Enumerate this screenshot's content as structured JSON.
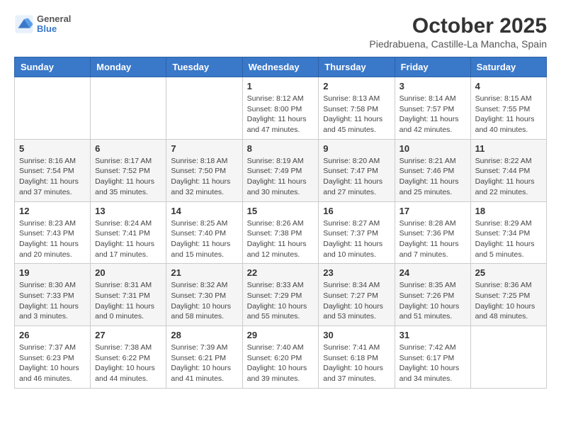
{
  "header": {
    "logo_general": "General",
    "logo_blue": "Blue",
    "month": "October 2025",
    "location": "Piedrabuena, Castille-La Mancha, Spain"
  },
  "weekdays": [
    "Sunday",
    "Monday",
    "Tuesday",
    "Wednesday",
    "Thursday",
    "Friday",
    "Saturday"
  ],
  "weeks": [
    [
      {
        "day": "",
        "info": ""
      },
      {
        "day": "",
        "info": ""
      },
      {
        "day": "",
        "info": ""
      },
      {
        "day": "1",
        "info": "Sunrise: 8:12 AM\nSunset: 8:00 PM\nDaylight: 11 hours and 47 minutes."
      },
      {
        "day": "2",
        "info": "Sunrise: 8:13 AM\nSunset: 7:58 PM\nDaylight: 11 hours and 45 minutes."
      },
      {
        "day": "3",
        "info": "Sunrise: 8:14 AM\nSunset: 7:57 PM\nDaylight: 11 hours and 42 minutes."
      },
      {
        "day": "4",
        "info": "Sunrise: 8:15 AM\nSunset: 7:55 PM\nDaylight: 11 hours and 40 minutes."
      }
    ],
    [
      {
        "day": "5",
        "info": "Sunrise: 8:16 AM\nSunset: 7:54 PM\nDaylight: 11 hours and 37 minutes."
      },
      {
        "day": "6",
        "info": "Sunrise: 8:17 AM\nSunset: 7:52 PM\nDaylight: 11 hours and 35 minutes."
      },
      {
        "day": "7",
        "info": "Sunrise: 8:18 AM\nSunset: 7:50 PM\nDaylight: 11 hours and 32 minutes."
      },
      {
        "day": "8",
        "info": "Sunrise: 8:19 AM\nSunset: 7:49 PM\nDaylight: 11 hours and 30 minutes."
      },
      {
        "day": "9",
        "info": "Sunrise: 8:20 AM\nSunset: 7:47 PM\nDaylight: 11 hours and 27 minutes."
      },
      {
        "day": "10",
        "info": "Sunrise: 8:21 AM\nSunset: 7:46 PM\nDaylight: 11 hours and 25 minutes."
      },
      {
        "day": "11",
        "info": "Sunrise: 8:22 AM\nSunset: 7:44 PM\nDaylight: 11 hours and 22 minutes."
      }
    ],
    [
      {
        "day": "12",
        "info": "Sunrise: 8:23 AM\nSunset: 7:43 PM\nDaylight: 11 hours and 20 minutes."
      },
      {
        "day": "13",
        "info": "Sunrise: 8:24 AM\nSunset: 7:41 PM\nDaylight: 11 hours and 17 minutes."
      },
      {
        "day": "14",
        "info": "Sunrise: 8:25 AM\nSunset: 7:40 PM\nDaylight: 11 hours and 15 minutes."
      },
      {
        "day": "15",
        "info": "Sunrise: 8:26 AM\nSunset: 7:38 PM\nDaylight: 11 hours and 12 minutes."
      },
      {
        "day": "16",
        "info": "Sunrise: 8:27 AM\nSunset: 7:37 PM\nDaylight: 11 hours and 10 minutes."
      },
      {
        "day": "17",
        "info": "Sunrise: 8:28 AM\nSunset: 7:36 PM\nDaylight: 11 hours and 7 minutes."
      },
      {
        "day": "18",
        "info": "Sunrise: 8:29 AM\nSunset: 7:34 PM\nDaylight: 11 hours and 5 minutes."
      }
    ],
    [
      {
        "day": "19",
        "info": "Sunrise: 8:30 AM\nSunset: 7:33 PM\nDaylight: 11 hours and 3 minutes."
      },
      {
        "day": "20",
        "info": "Sunrise: 8:31 AM\nSunset: 7:31 PM\nDaylight: 11 hours and 0 minutes."
      },
      {
        "day": "21",
        "info": "Sunrise: 8:32 AM\nSunset: 7:30 PM\nDaylight: 10 hours and 58 minutes."
      },
      {
        "day": "22",
        "info": "Sunrise: 8:33 AM\nSunset: 7:29 PM\nDaylight: 10 hours and 55 minutes."
      },
      {
        "day": "23",
        "info": "Sunrise: 8:34 AM\nSunset: 7:27 PM\nDaylight: 10 hours and 53 minutes."
      },
      {
        "day": "24",
        "info": "Sunrise: 8:35 AM\nSunset: 7:26 PM\nDaylight: 10 hours and 51 minutes."
      },
      {
        "day": "25",
        "info": "Sunrise: 8:36 AM\nSunset: 7:25 PM\nDaylight: 10 hours and 48 minutes."
      }
    ],
    [
      {
        "day": "26",
        "info": "Sunrise: 7:37 AM\nSunset: 6:23 PM\nDaylight: 10 hours and 46 minutes."
      },
      {
        "day": "27",
        "info": "Sunrise: 7:38 AM\nSunset: 6:22 PM\nDaylight: 10 hours and 44 minutes."
      },
      {
        "day": "28",
        "info": "Sunrise: 7:39 AM\nSunset: 6:21 PM\nDaylight: 10 hours and 41 minutes."
      },
      {
        "day": "29",
        "info": "Sunrise: 7:40 AM\nSunset: 6:20 PM\nDaylight: 10 hours and 39 minutes."
      },
      {
        "day": "30",
        "info": "Sunrise: 7:41 AM\nSunset: 6:18 PM\nDaylight: 10 hours and 37 minutes."
      },
      {
        "day": "31",
        "info": "Sunrise: 7:42 AM\nSunset: 6:17 PM\nDaylight: 10 hours and 34 minutes."
      },
      {
        "day": "",
        "info": ""
      }
    ]
  ]
}
